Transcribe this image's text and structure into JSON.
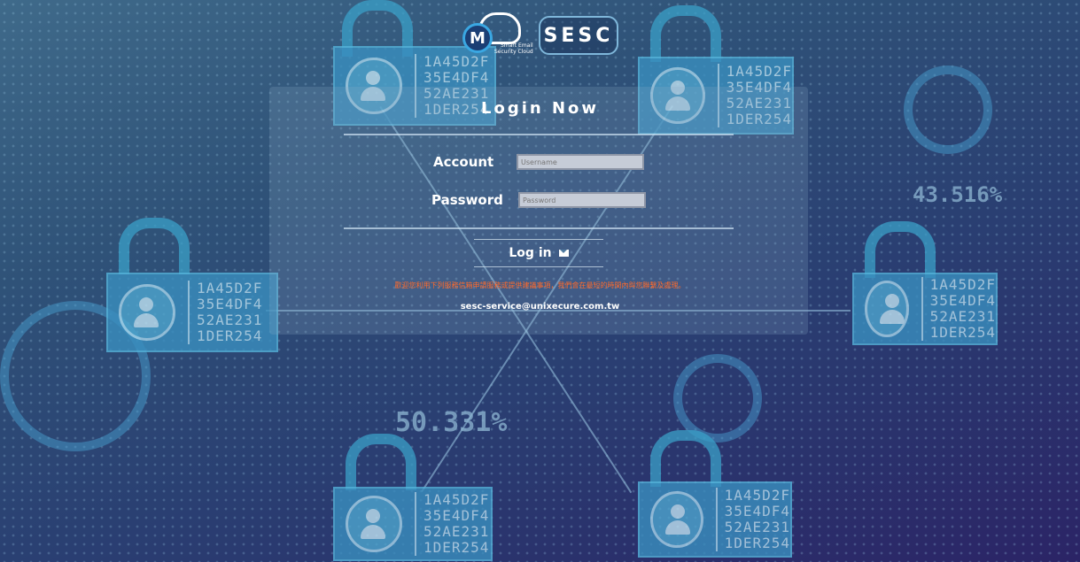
{
  "background": {
    "lock_codes": [
      "1A45D2F",
      "35E4DF4",
      "52AE231",
      "1DER254"
    ],
    "numbers": [
      "43.516%",
      "50.331%"
    ]
  },
  "header": {
    "cloud_logo_letter": "M",
    "cloud_logo_text_line1": "Smart Email",
    "cloud_logo_text_line2": "Security Cloud",
    "brand": "SESC"
  },
  "login": {
    "title": "Login Now",
    "account_label": "Account",
    "username_placeholder": "Username",
    "password_label": "Password",
    "password_placeholder": "Password",
    "login_button": "Log in",
    "notice": "歡迎您利用下列服務信箱申請服務或提供建議事項，我們會在最短的時間內與您聯繫及處理。",
    "contact_email": "sesc-service@unixecure.com.tw"
  },
  "colors": {
    "notice": "#ff6a2b",
    "accent": "#3aa7e2"
  }
}
